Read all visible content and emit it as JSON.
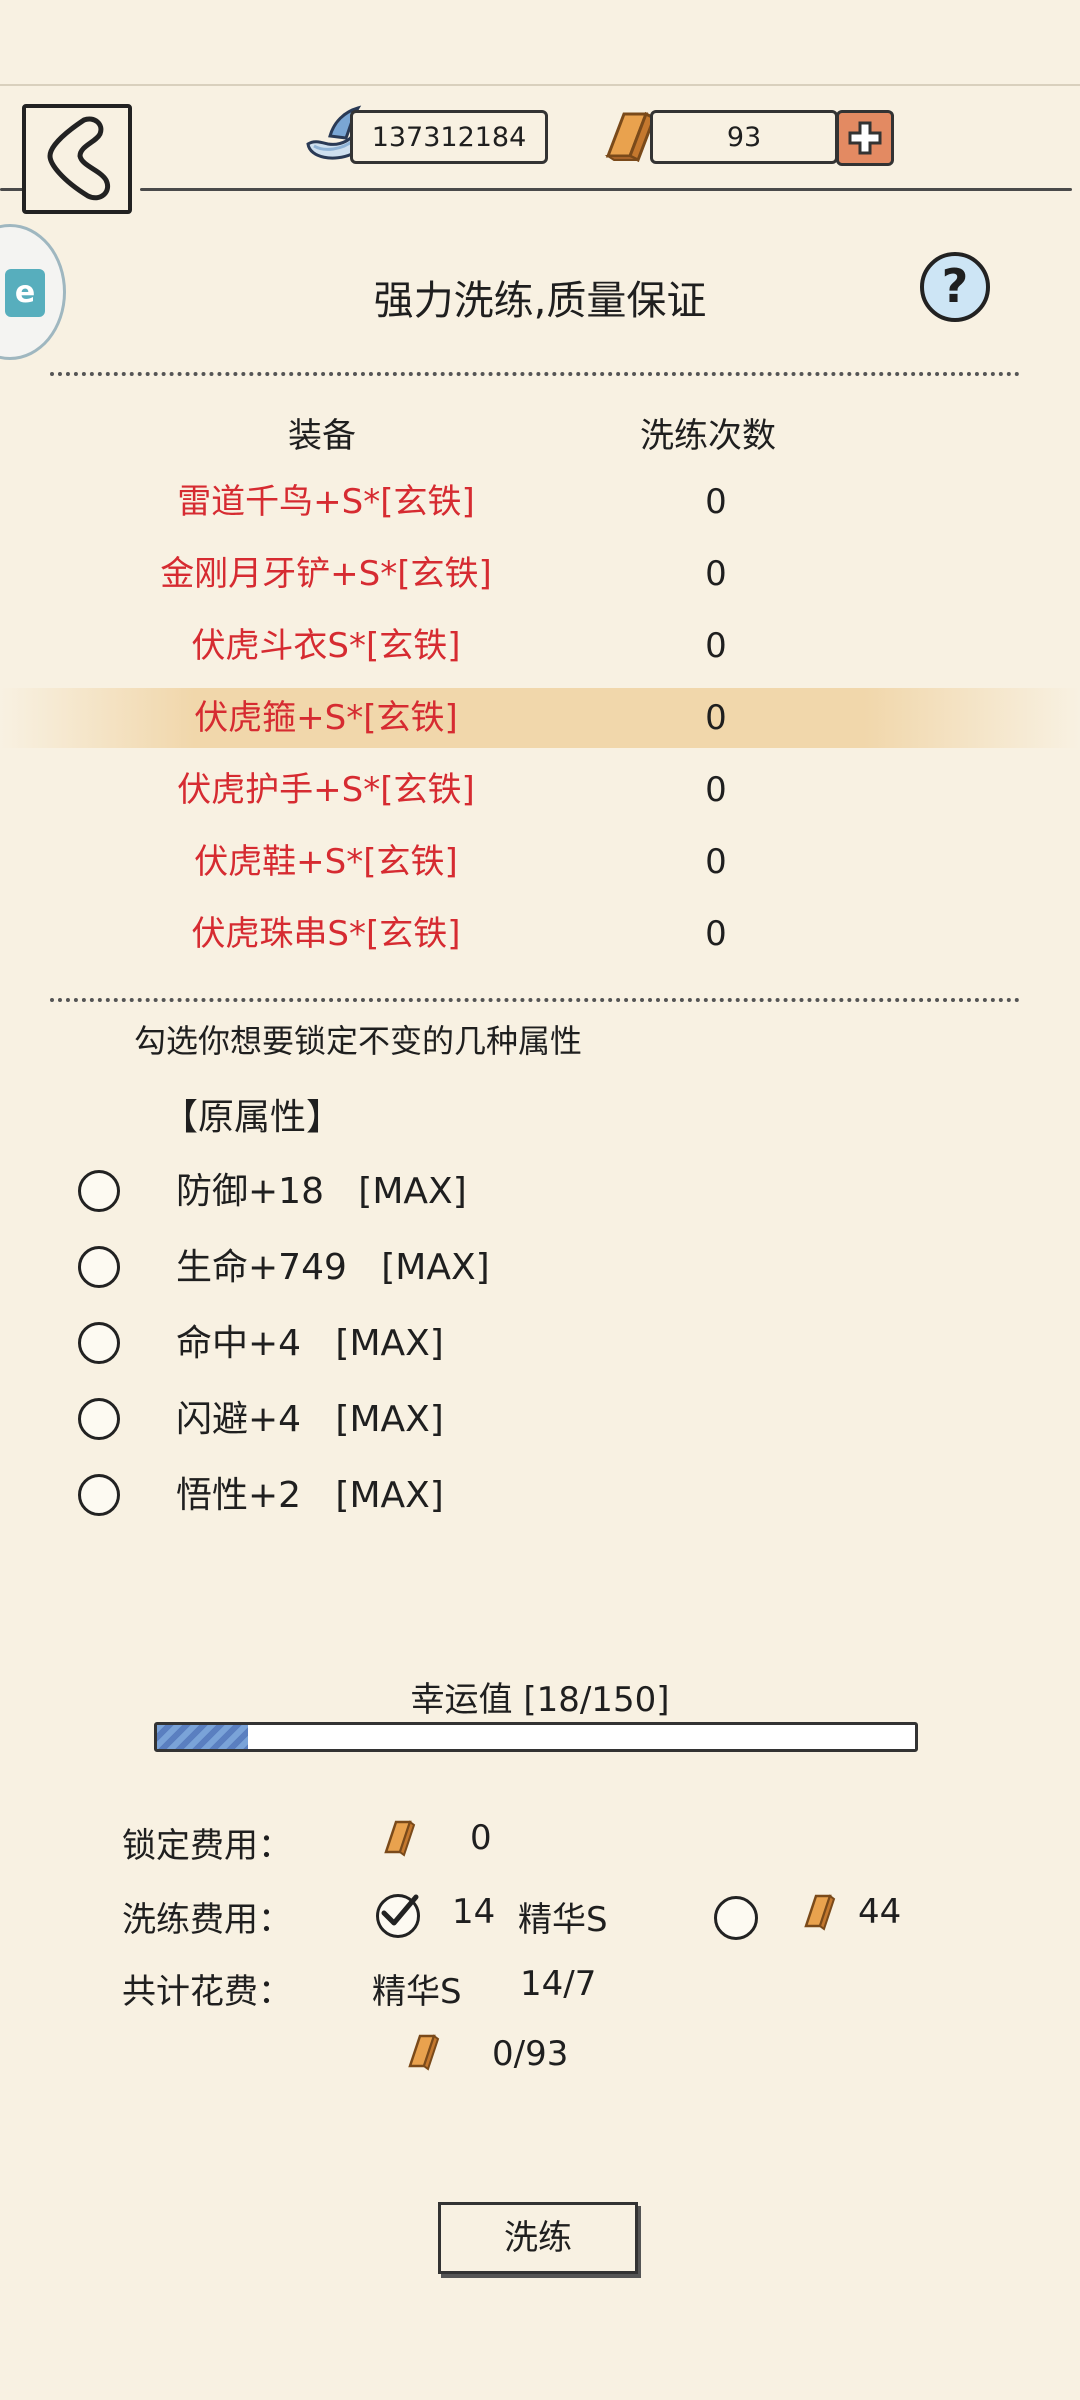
{
  "header": {
    "silver_value": "137312184",
    "gold_value": "93",
    "side_tab_text": "e"
  },
  "title": "强力洗练,质量保证",
  "help_text": "?",
  "equipment_table": {
    "col_equipment": "装备",
    "col_count": "洗练次数",
    "rows": [
      {
        "name": "雷道千鸟+S*[玄铁]",
        "count": "0"
      },
      {
        "name": "金刚月牙铲+S*[玄铁]",
        "count": "0"
      },
      {
        "name": "伏虎斗衣S*[玄铁]",
        "count": "0"
      },
      {
        "name": "伏虎箍+S*[玄铁]",
        "count": "0"
      },
      {
        "name": "伏虎护手+S*[玄铁]",
        "count": "0"
      },
      {
        "name": "伏虎鞋+S*[玄铁]",
        "count": "0"
      },
      {
        "name": "伏虎珠串S*[玄铁]",
        "count": "0"
      }
    ]
  },
  "lock_hint": "勾选你想要锁定不变的几种属性",
  "original_attrs_title": "【原属性】",
  "attributes": [
    {
      "label": "防御+18   [MAX]"
    },
    {
      "label": "生命+749   [MAX]"
    },
    {
      "label": "命中+4   [MAX]"
    },
    {
      "label": "闪避+4   [MAX]"
    },
    {
      "label": "悟性+2   [MAX]"
    }
  ],
  "luck": {
    "label": "幸运值  [18/150]",
    "current": 18,
    "max": 150
  },
  "costs": {
    "lock_label": "锁定费用：",
    "lock_value": "0",
    "wash_label": "洗练费用：",
    "wash_option1_amount": "14",
    "wash_option1_item": "精华S",
    "wash_option2_amount": "44",
    "total_label": "共计花费：",
    "total_item": "精华S",
    "total_item_amount": "14/7",
    "total_gold": "0/93"
  },
  "wash_button": "洗练",
  "colors": {
    "background": "#f8f1e2",
    "equipment_name": "#d62b31",
    "plus_button": "#e38a62",
    "gold": "#e9a24e"
  }
}
